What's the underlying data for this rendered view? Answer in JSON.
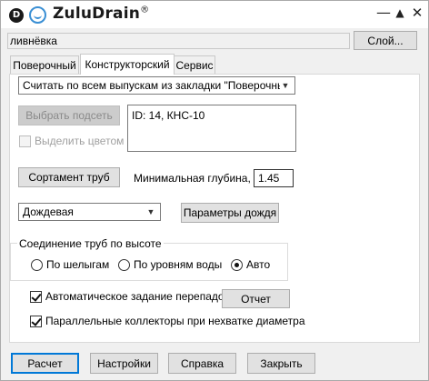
{
  "titlebar": {
    "logo_letter": "D",
    "app_name": "ZuluDrain",
    "reg_mark": "®",
    "min_glyph": "—",
    "max_glyph": "▲",
    "close_glyph": "✕"
  },
  "layer": {
    "value": "ливнёвка",
    "button_label": "Слой..."
  },
  "tabs": [
    {
      "label": "Поверочный",
      "active": false
    },
    {
      "label": "Конструкторский",
      "active": true
    },
    {
      "label": "Сервис",
      "active": false
    }
  ],
  "calc_mode": {
    "selected": "Считать по всем выпускам из закладки \"Поверочный\""
  },
  "select_subnet_button": "Выбрать подсеть",
  "highlight_color_checkbox": {
    "label": "Выделить цветом",
    "checked": false,
    "disabled": true
  },
  "selection_info": "ID: 14, КНС-10",
  "pipe_assortment_button": "Сортамент труб",
  "min_depth": {
    "label": "Минимальная глубина, м:",
    "value": "1.45"
  },
  "water_type": {
    "selected": "Дождевая"
  },
  "rain_params_button": "Параметры дождя",
  "connection_group": {
    "title": "Соединение труб по высоте",
    "options": [
      {
        "label": "По шелыгам",
        "selected": false
      },
      {
        "label": "По уровням воды",
        "selected": false
      },
      {
        "label": "Авто",
        "selected": true
      }
    ]
  },
  "auto_drops": {
    "label": "Автоматическое задание перепадов",
    "checked": true
  },
  "report_button": "Отчет",
  "parallel_collectors": {
    "label": "Параллельные коллекторы при нехватке диаметра",
    "checked": true
  },
  "footer": {
    "calc_button": "Расчет",
    "settings_button": "Настройки",
    "help_button": "Справка",
    "close_button": "Закрыть"
  },
  "colors": {
    "accent": "#0078d7",
    "logo_blue": "#3a8fd4",
    "window_bg": "#f0f0f0"
  },
  "icons": [
    "zulu-d-logo-icon",
    "smile-logo-icon",
    "minimize-icon",
    "maximize-icon",
    "close-icon",
    "chevron-down-icon"
  ]
}
